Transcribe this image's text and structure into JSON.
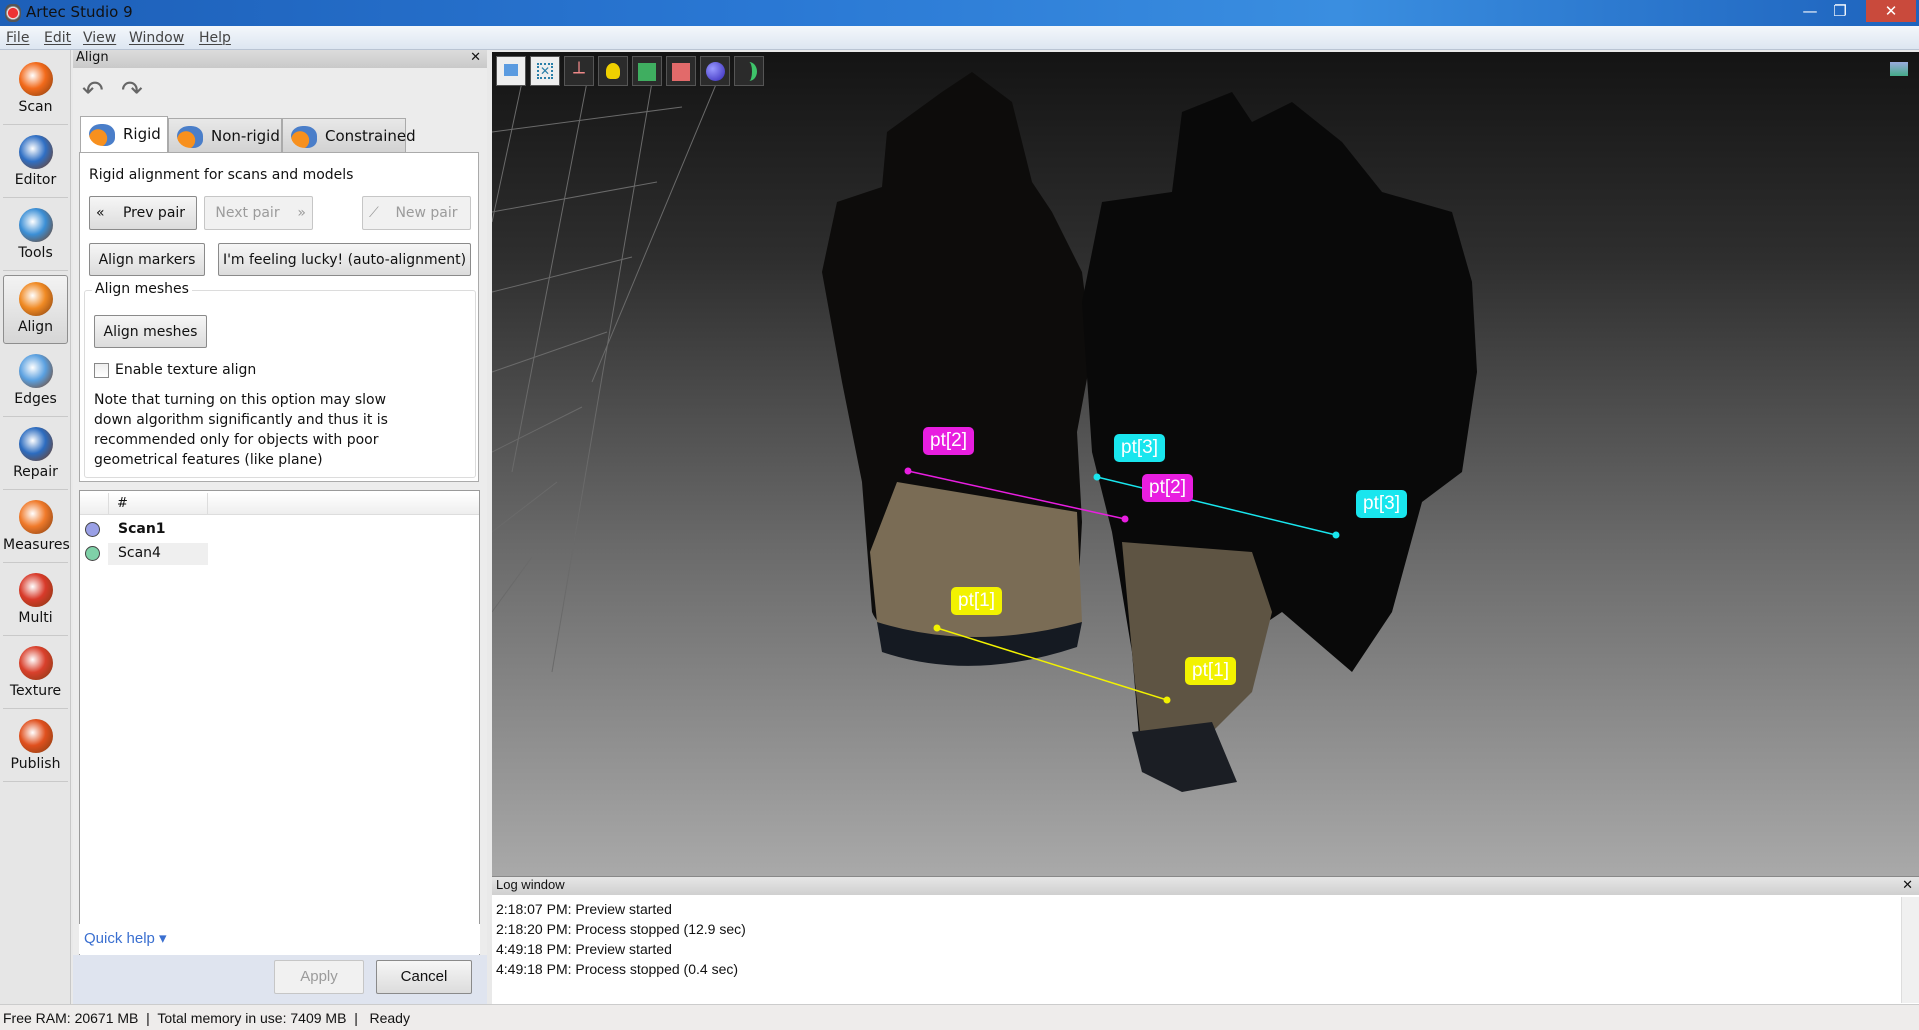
{
  "window": {
    "title": "Artec Studio 9",
    "minimize": "—",
    "maximize": "❐",
    "close": "✕"
  },
  "menu": [
    "File",
    "Edit",
    "View",
    "Window",
    "Help"
  ],
  "tools": [
    {
      "label": "Scan",
      "color": "#f26a1b"
    },
    {
      "label": "Editor",
      "color": "#2f6fc4"
    },
    {
      "label": "Tools",
      "color": "#3b8fd6"
    },
    {
      "label": "Align",
      "color": "#f08a24",
      "active": true
    },
    {
      "label": "Edges",
      "color": "#5aa0e0"
    },
    {
      "label": "Repair",
      "color": "#2c6cc0"
    },
    {
      "label": "Measures",
      "color": "#f07a2a"
    },
    {
      "label": "Multi",
      "color": "#d83a2a"
    },
    {
      "label": "Texture",
      "color": "#d9402c"
    },
    {
      "label": "Publish",
      "color": "#e0501e"
    }
  ],
  "panel": {
    "title": "Align",
    "close": "✕",
    "tabs": [
      {
        "label": "Rigid",
        "selected": true
      },
      {
        "label": "Non-rigid"
      },
      {
        "label": "Constrained"
      }
    ],
    "description": "Rigid alignment for scans and models",
    "prev_pair": "Prev pair",
    "next_pair": "Next pair",
    "new_pair": "New pair",
    "align_markers": "Align markers",
    "auto_align": "I'm feeling lucky! (auto-alignment)",
    "group_label": "Align meshes",
    "align_meshes": "Align meshes",
    "texture_checkbox": {
      "label": "Enable texture align",
      "checked": false
    },
    "note": "Note that turning on this option may slow down algorithm significantly and thus it is recommended only for objects with poor geometrical features (like plane)",
    "list": {
      "column": "#",
      "rows": [
        {
          "name": "Scan1",
          "color": "#9aa0e6",
          "bold": true
        },
        {
          "name": "Scan4",
          "color": "#7fd1a8",
          "bold": false
        }
      ]
    },
    "quick_help": "Quick help ▾",
    "apply": "Apply",
    "cancel": "Cancel"
  },
  "viewport": {
    "toolbar": [
      "home-view-icon",
      "fit-view-icon",
      "axes-icon",
      "light-bulb-icon",
      "textured-cube-icon",
      "solid-cube-icon",
      "sphere-icon",
      "crescent-icon"
    ],
    "markers": [
      {
        "label": "pt[2]",
        "color": "#e81ee0"
      },
      {
        "label": "pt[3]",
        "color": "#19e6ee"
      },
      {
        "label": "pt[2]",
        "color": "#e81ee0"
      },
      {
        "label": "pt[3]",
        "color": "#19e6ee"
      },
      {
        "label": "pt[1]",
        "color": "#f2f200"
      },
      {
        "label": "pt[1]",
        "color": "#f2f200"
      }
    ]
  },
  "log": {
    "title": "Log window",
    "close": "✕",
    "lines": [
      "2:18:07 PM: Preview started",
      "2:18:20 PM: Process stopped (12.9 sec)",
      "4:49:18 PM: Preview started",
      "4:49:18 PM: Process stopped (0.4 sec)"
    ]
  },
  "status": "Free RAM: 20671 MB  |  Total memory in use: 7409 MB  |   Ready"
}
